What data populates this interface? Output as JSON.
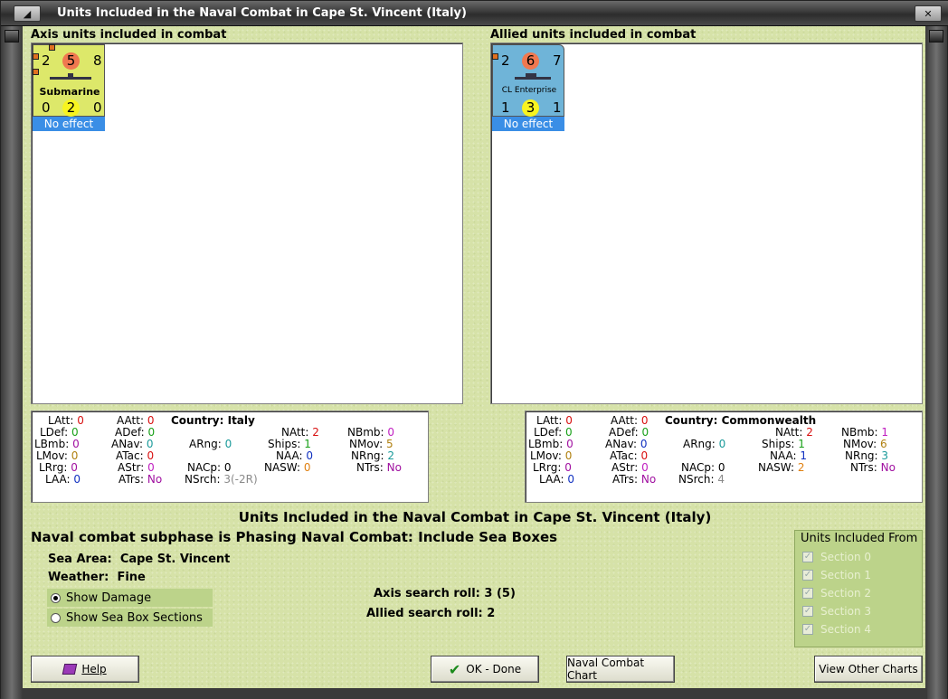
{
  "window": {
    "title": "Units Included in the Naval Combat in Cape St. Vincent (Italy)",
    "minimize_glyph": "◢",
    "close_glyph": "✕"
  },
  "axis": {
    "header": "Axis units included in combat",
    "counter": {
      "top_left": "2",
      "top_mid": "5",
      "top_right": "8",
      "name": "Submarine",
      "bot_left": "0",
      "bot_mid": "2",
      "bot_right": "0",
      "effect": "No effect"
    },
    "stats": {
      "LAtt": {
        "label": "LAtt:",
        "value": "0"
      },
      "LDef": {
        "label": "LDef:",
        "value": "0"
      },
      "LBmb": {
        "label": "LBmb:",
        "value": "0"
      },
      "LMov": {
        "label": "LMov:",
        "value": "0"
      },
      "LRrg": {
        "label": "LRrg:",
        "value": "0"
      },
      "LAA": {
        "label": "LAA:",
        "value": "0"
      },
      "AAtt": {
        "label": "AAtt:",
        "value": "0"
      },
      "ADef": {
        "label": "ADef:",
        "value": "0"
      },
      "ANav": {
        "label": "ANav:",
        "value": "0"
      },
      "ATac": {
        "label": "ATac:",
        "value": "0"
      },
      "AStr": {
        "label": "AStr:",
        "value": "0"
      },
      "ATrs": {
        "label": "ATrs:",
        "value": "No"
      },
      "country_label": "Country:",
      "country": "Italy",
      "ARng": {
        "label": "ARng:",
        "value": "0"
      },
      "NACp": {
        "label": "NACp:",
        "value": "0"
      },
      "NSrch": {
        "label": "NSrch:",
        "value": "3(-2R)"
      },
      "NAtt": {
        "label": "NAtt:",
        "value": "2"
      },
      "Ships": {
        "label": "Ships:",
        "value": "1"
      },
      "NAA": {
        "label": "NAA:",
        "value": "0"
      },
      "NASW": {
        "label": "NASW:",
        "value": "0"
      },
      "NBmb": {
        "label": "NBmb:",
        "value": "0"
      },
      "NMov": {
        "label": "NMov:",
        "value": "5"
      },
      "NRng": {
        "label": "NRng:",
        "value": "2"
      },
      "NTrs": {
        "label": "NTrs:",
        "value": "No"
      }
    }
  },
  "allied": {
    "header": "Allied units included in combat",
    "counter": {
      "top_left": "2",
      "top_mid": "6",
      "top_right": "7",
      "name": "CL Enterprise",
      "bot_left": "1",
      "bot_mid": "3",
      "bot_right": "1",
      "effect": "No effect"
    },
    "stats": {
      "LAtt": {
        "label": "LAtt:",
        "value": "0"
      },
      "LDef": {
        "label": "LDef:",
        "value": "0"
      },
      "LBmb": {
        "label": "LBmb:",
        "value": "0"
      },
      "LMov": {
        "label": "LMov:",
        "value": "0"
      },
      "LRrg": {
        "label": "LRrg:",
        "value": "0"
      },
      "LAA": {
        "label": "LAA:",
        "value": "0"
      },
      "AAtt": {
        "label": "AAtt:",
        "value": "0"
      },
      "ADef": {
        "label": "ADef:",
        "value": "0"
      },
      "ANav": {
        "label": "ANav:",
        "value": "0"
      },
      "ATac": {
        "label": "ATac:",
        "value": "0"
      },
      "AStr": {
        "label": "AStr:",
        "value": "0"
      },
      "ATrs": {
        "label": "ATrs:",
        "value": "No"
      },
      "country_label": "Country:",
      "country": "Commonwealth",
      "ARng": {
        "label": "ARng:",
        "value": "0"
      },
      "NACp": {
        "label": "NACp:",
        "value": "0"
      },
      "NSrch": {
        "label": "NSrch:",
        "value": "4"
      },
      "NAtt": {
        "label": "NAtt:",
        "value": "2"
      },
      "Ships": {
        "label": "Ships:",
        "value": "1"
      },
      "NAA": {
        "label": "NAA:",
        "value": "1"
      },
      "NASW": {
        "label": "NASW:",
        "value": "2"
      },
      "NBmb": {
        "label": "NBmb:",
        "value": "1"
      },
      "NMov": {
        "label": "NMov:",
        "value": "6"
      },
      "NRng": {
        "label": "NRng:",
        "value": "3"
      },
      "NTrs": {
        "label": "NTrs:",
        "value": "No"
      }
    }
  },
  "summary": {
    "title": "Units Included in the Naval Combat in Cape St. Vincent (Italy)",
    "subphase": "Naval combat subphase is Phasing Naval Combat: Include Sea Boxes",
    "sea_area_label": "Sea Area:",
    "sea_area": "Cape St. Vincent",
    "weather_label": "Weather:",
    "weather": "Fine",
    "axis_roll_label": "Axis search roll:",
    "axis_roll": "3 (5)",
    "allied_roll_label": "Allied search roll:",
    "allied_roll": "2"
  },
  "options": {
    "show_damage": "Show Damage",
    "show_sea_box": "Show Sea Box Sections"
  },
  "units_from": {
    "title": "Units Included From",
    "sections": [
      "Section 0",
      "Section 1",
      "Section 2",
      "Section 3",
      "Section 4"
    ]
  },
  "buttons": {
    "help": "Help",
    "ok": "OK - Done",
    "naval_chart": "Naval Combat Chart",
    "other_charts": "View Other Charts"
  },
  "colors": {
    "background": "#d6e2a8",
    "axis_counter": "#dde86a",
    "allied_counter": "#6fb4d8",
    "effect_bar": "#3a8ee6"
  }
}
